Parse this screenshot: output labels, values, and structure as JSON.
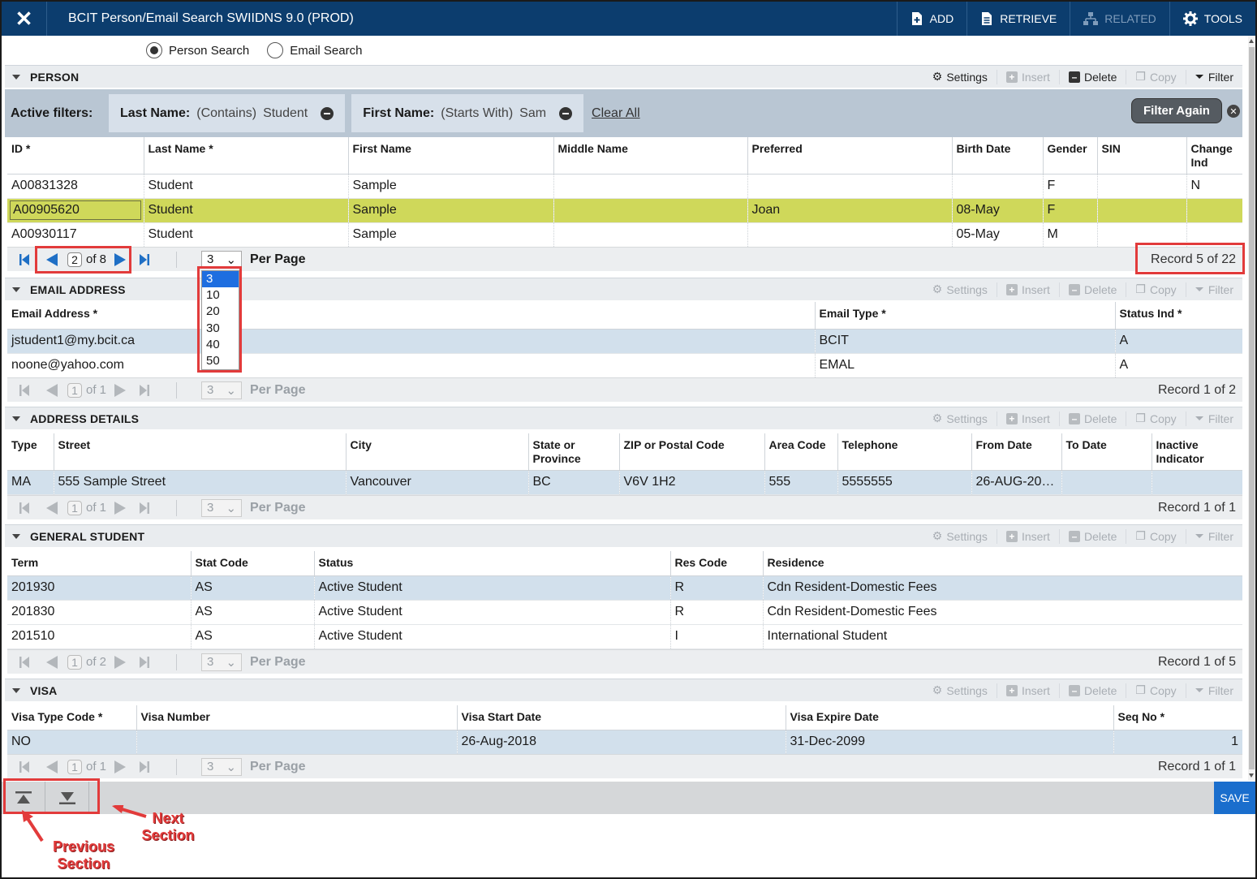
{
  "app": {
    "title": "BCIT Person/Email Search SWIIDNS 9.0 (PROD)",
    "toolbar": {
      "add": "ADD",
      "retrieve": "RETRIEVE",
      "related": "RELATED",
      "tools": "TOOLS"
    }
  },
  "search_mode": {
    "options": [
      "Person Search",
      "Email Search"
    ],
    "selected": "Person Search"
  },
  "section_actions": {
    "settings": "Settings",
    "insert": "Insert",
    "delete": "Delete",
    "copy": "Copy",
    "filter": "Filter"
  },
  "person": {
    "title": "PERSON",
    "active_filters_label": "Active filters:",
    "filters": [
      {
        "field": "Last Name:",
        "op": "(Contains)",
        "value": "Student"
      },
      {
        "field": "First Name:",
        "op": "(Starts With)",
        "value": "Sam"
      }
    ],
    "clear_all": "Clear All",
    "filter_again": "Filter Again",
    "columns": [
      "ID *",
      "Last Name *",
      "First Name",
      "Middle Name",
      "Preferred",
      "Birth Date",
      "Gender",
      "SIN",
      "Change Ind"
    ],
    "rows": [
      [
        "A00831328",
        "Student",
        "Sample",
        "",
        "",
        "",
        "F",
        "",
        "N"
      ],
      [
        "A00905620",
        "Student",
        "Sample",
        "",
        "Joan",
        "08-May",
        "F",
        "",
        ""
      ],
      [
        "A00930117",
        "Student",
        "Sample",
        "",
        "",
        "05-May",
        "M",
        "",
        ""
      ]
    ],
    "pager": {
      "page": "2",
      "of": "of 8",
      "per_page_value": "3",
      "per_page_label": "Per Page",
      "record": "Record 5 of 22"
    },
    "per_page_options": [
      "3",
      "10",
      "20",
      "30",
      "40",
      "50"
    ]
  },
  "email": {
    "title": "EMAIL ADDRESS",
    "columns": [
      "Email Address *",
      "Email Type *",
      "Status Ind *"
    ],
    "rows": [
      [
        "jstudent1@my.bcit.ca",
        "BCIT",
        "A"
      ],
      [
        "noone@yahoo.com",
        "EMAL",
        "A"
      ]
    ],
    "pager": {
      "page": "1",
      "of": "of 1",
      "per_page_value": "3",
      "per_page_label": "Per Page",
      "record": "Record 1 of 2"
    }
  },
  "address": {
    "title": "ADDRESS DETAILS",
    "columns": [
      "Type",
      "Street",
      "City",
      "State or Province",
      "ZIP or Postal Code",
      "Area Code",
      "Telephone",
      "From Date",
      "To Date",
      "Inactive Indicator"
    ],
    "rows": [
      [
        "MA",
        "555 Sample Street",
        "Vancouver",
        "BC",
        "V6V 1H2",
        "555",
        "5555555",
        "26-AUG-20…",
        "",
        ""
      ]
    ],
    "pager": {
      "page": "1",
      "of": "of 1",
      "per_page_value": "3",
      "per_page_label": "Per Page",
      "record": "Record 1 of 1"
    }
  },
  "general_student": {
    "title": "GENERAL STUDENT",
    "columns": [
      "Term",
      "Stat Code",
      "Status",
      "Res Code",
      "Residence"
    ],
    "rows": [
      [
        "201930",
        "AS",
        "Active Student",
        "R",
        "Cdn Resident-Domestic Fees"
      ],
      [
        "201830",
        "AS",
        "Active Student",
        "R",
        "Cdn Resident-Domestic Fees"
      ],
      [
        "201510",
        "AS",
        "Active Student",
        "I",
        "International Student"
      ]
    ],
    "pager": {
      "page": "1",
      "of": "of 2",
      "per_page_value": "3",
      "per_page_label": "Per Page",
      "record": "Record 1 of 5"
    }
  },
  "visa": {
    "title": "VISA",
    "columns": [
      "Visa Type Code *",
      "Visa Number",
      "Visa Start Date",
      "Visa Expire Date",
      "Seq No *"
    ],
    "rows": [
      [
        "NO",
        "",
        "26-Aug-2018",
        "31-Dec-2099",
        "1"
      ]
    ],
    "pager": {
      "page": "1",
      "of": "of 1",
      "per_page_value": "3",
      "per_page_label": "Per Page",
      "record": "Record 1 of 1"
    }
  },
  "bottom": {
    "save": "SAVE"
  },
  "annotations": {
    "previous_section": "Previous Section",
    "next_section": "Next Section"
  },
  "colors": {
    "header": "#0c3d6e",
    "highlight_row": "#cfd85a",
    "selected_row": "#d2e0ec",
    "annotation": "#e23b3b",
    "save": "#1a6ecd"
  }
}
